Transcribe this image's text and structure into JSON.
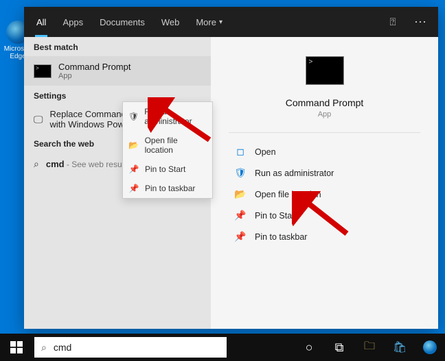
{
  "desktop": {
    "icon_label": "Microsoft Edge"
  },
  "tabs": {
    "all": "All",
    "apps": "Apps",
    "documents": "Documents",
    "web": "Web",
    "more": "More"
  },
  "left": {
    "best_match": "Best match",
    "app_name": "Command Prompt",
    "app_sub": "App",
    "settings": "Settings",
    "settings_item": "Replace Command Prompt with Windows PowerShell",
    "search_web": "Search the web",
    "web_query": "cmd",
    "web_hint": " - See web results"
  },
  "context_menu": [
    "Run as administrator",
    "Open file location",
    "Pin to Start",
    "Pin to taskbar"
  ],
  "right": {
    "title": "Command Prompt",
    "sub": "App",
    "actions": [
      "Open",
      "Run as administrator",
      "Open file location",
      "Pin to Start",
      "Pin to taskbar"
    ]
  },
  "taskbar": {
    "search_text": "cmd"
  }
}
